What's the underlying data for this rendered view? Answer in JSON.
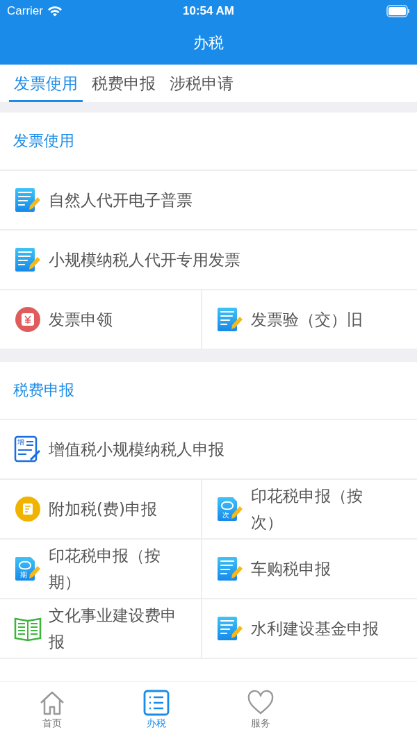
{
  "status_bar": {
    "carrier": "Carrier",
    "time": "10:54 AM"
  },
  "nav": {
    "title": "办税"
  },
  "tabs": [
    {
      "label": "发票使用",
      "selected": true
    },
    {
      "label": "税费申报",
      "selected": false
    },
    {
      "label": "涉税申请",
      "selected": false
    }
  ],
  "sections": [
    {
      "title": "发票使用",
      "rows": [
        [
          {
            "label": "自然人代开电子普票",
            "kind": "form"
          }
        ],
        [
          {
            "label": "小规模纳税人代开专用发票",
            "kind": "form"
          }
        ],
        [
          {
            "label": "发票申领",
            "kind": "ticket"
          },
          {
            "label": "发票验（交）旧",
            "kind": "form"
          }
        ]
      ]
    },
    {
      "title": "税费申报",
      "rows": [
        [
          {
            "label": "增值税小规模纳税人申报",
            "kind": "vat",
            "badge": "增"
          }
        ],
        [
          {
            "label": "附加税(费)申报",
            "kind": "note"
          },
          {
            "label": "印花税申报（按次）",
            "kind": "stamp",
            "badge": "次"
          }
        ],
        [
          {
            "label": "印花税申报（按期）",
            "kind": "stamp",
            "badge": "期"
          },
          {
            "label": "车购税申报",
            "kind": "form"
          }
        ],
        [
          {
            "label": "文化事业建设费申报",
            "kind": "book"
          },
          {
            "label": "水利建设基金申报",
            "kind": "form"
          }
        ]
      ]
    }
  ],
  "tab_bar": [
    {
      "label": "首页",
      "kind": "home",
      "selected": false
    },
    {
      "label": "办税",
      "kind": "list",
      "selected": true
    },
    {
      "label": "服务",
      "kind": "heart",
      "selected": false
    }
  ]
}
